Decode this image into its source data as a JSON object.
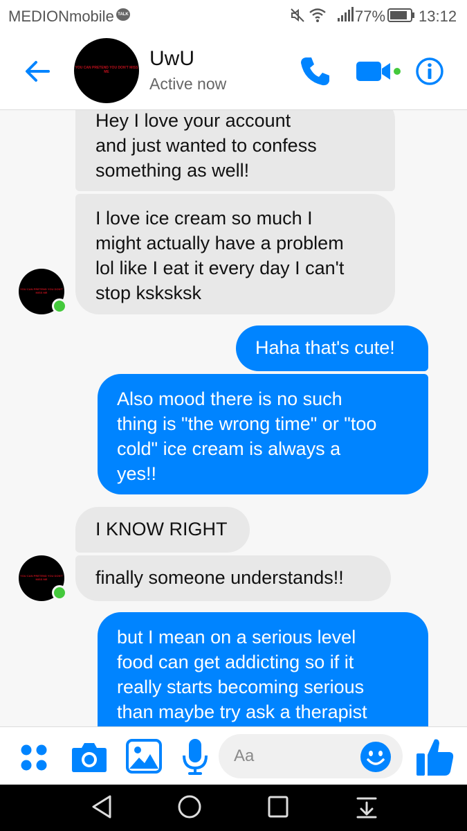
{
  "status_bar": {
    "carrier": "MEDIONmobile",
    "talk_badge": "TALK",
    "battery_percent": "77%",
    "time": "13:12"
  },
  "header": {
    "contact_name": "UwU",
    "contact_status": "Active now",
    "avatar_text": "YOU CAN PRETEND YOU DON'T MISS ME"
  },
  "messages": [
    {
      "side": "in",
      "text": "Hey I love your account\nand just wanted to confess\nsomething as well!"
    },
    {
      "side": "in",
      "text": "I love ice cream so much I\nmight actually have a problem\nlol like I eat it every day I can't\nstop ksksksk"
    },
    {
      "side": "out",
      "text": "Haha that's cute!"
    },
    {
      "side": "out",
      "text": "Also mood there is no such\nthing is \"the wrong time\" or \"too\ncold\" ice cream is always a\nyes!!"
    },
    {
      "side": "in",
      "text": "I KNOW RIGHT"
    },
    {
      "side": "in",
      "text": "finally someone understands!!"
    },
    {
      "side": "out",
      "text": "but I mean on a serious level\nfood can get addicting so if it\nreally starts becoming serious\nthan maybe try ask a therapist"
    }
  ],
  "composer": {
    "placeholder": "Aa"
  },
  "colors": {
    "accent": "#0084ff",
    "incoming_bubble": "#e8e8e8",
    "online": "#44c93c"
  }
}
